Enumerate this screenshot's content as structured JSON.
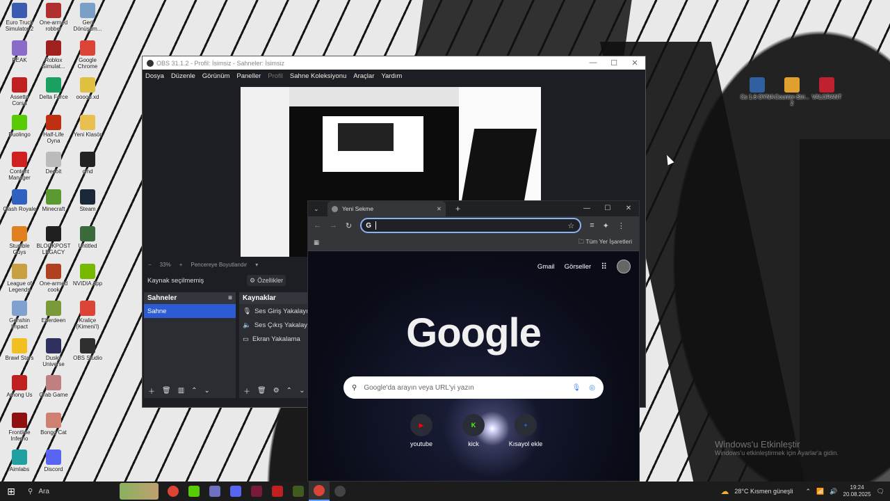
{
  "desktop": {
    "icons_left": [
      {
        "label": "Euro Truck Simulator 2",
        "color": "#3a5bb0"
      },
      {
        "label": "One-armed robber",
        "color": "#b03030"
      },
      {
        "label": "Geri Dönüşüm...",
        "color": "#7aa0c8"
      },
      {
        "label": "PEAK",
        "color": "#8a6bc8"
      },
      {
        "label": "Roblox Simulat...",
        "color": "#a02020"
      },
      {
        "label": "Google Chrome",
        "color": "#db4437"
      },
      {
        "label": "Assetto Corsa",
        "color": "#c02020"
      },
      {
        "label": "Delta Force",
        "color": "#1aa060"
      },
      {
        "label": "ooooo.xd",
        "color": "#e0c040"
      },
      {
        "label": "Duolingo",
        "color": "#58cc02"
      },
      {
        "label": "Half-Life Oyna",
        "color": "#c03010"
      },
      {
        "label": "Yeni Klasör",
        "color": "#e8c050"
      },
      {
        "label": "Content Manager",
        "color": "#d02020"
      },
      {
        "label": "Decoit",
        "color": "#bbbbbb"
      },
      {
        "label": "cmd",
        "color": "#222222"
      },
      {
        "label": "Clash Royale",
        "color": "#3060c0"
      },
      {
        "label": "Minecraft",
        "color": "#5a9a30"
      },
      {
        "label": "Steam",
        "color": "#1b2838"
      },
      {
        "label": "Stumble Guys",
        "color": "#e08020"
      },
      {
        "label": "BLOCKPOST LEGACY",
        "color": "#202020"
      },
      {
        "label": "Untitled",
        "color": "#3a6a3a"
      },
      {
        "label": "League of Legends",
        "color": "#c8a040"
      },
      {
        "label": "One-armed cook",
        "color": "#b04020"
      },
      {
        "label": "NVIDIA App",
        "color": "#76b900"
      },
      {
        "label": "Genshin Impact",
        "color": "#80a0d0"
      },
      {
        "label": "Eberdeen",
        "color": "#7a9a3a"
      },
      {
        "label": "Kraliçe (Kimeni'l)",
        "color": "#db4437"
      },
      {
        "label": "Brawl Stars",
        "color": "#f0c020"
      },
      {
        "label": "Dusky Universe",
        "color": "#303060"
      },
      {
        "label": "OBS Studio",
        "color": "#302e31"
      },
      {
        "label": "Among Us",
        "color": "#c02020"
      },
      {
        "label": "Crab Game",
        "color": "#c08080"
      },
      {
        "label": "",
        "color": ""
      },
      {
        "label": "Frontline Inferno",
        "color": "#901010"
      },
      {
        "label": "Bongo Cat",
        "color": "#d08070"
      },
      {
        "label": "",
        "color": ""
      },
      {
        "label": "Aimlabs",
        "color": "#20a0a0"
      },
      {
        "label": "Discord",
        "color": "#5865f2"
      },
      {
        "label": "",
        "color": ""
      }
    ],
    "icons_right": [
      {
        "label": "Cs 1.6 OYNA",
        "color": "#3060a0"
      },
      {
        "label": "Counter-Stri... 2",
        "color": "#e0a030"
      },
      {
        "label": "VALORANT",
        "color": "#c02030"
      }
    ],
    "activation": {
      "line1": "Windows'u Etkinleştir",
      "line2": "Windows'u etkinleştirmek için Ayarlar'a gidin."
    }
  },
  "obs": {
    "title": "OBS 31.1.2 - Profil: İsimsiz - Sahneler: İsimsiz",
    "window_controls": [
      "—",
      "☐",
      "✕"
    ],
    "menu": [
      {
        "label": "Dosya",
        "dim": false
      },
      {
        "label": "Düzenle",
        "dim": false
      },
      {
        "label": "Görünüm",
        "dim": false
      },
      {
        "label": "Paneller",
        "dim": false
      },
      {
        "label": "Profil",
        "dim": true
      },
      {
        "label": "Sahne Koleksiyonu",
        "dim": false
      },
      {
        "label": "Araçlar",
        "dim": false
      },
      {
        "label": "Yardım",
        "dim": false
      }
    ],
    "zoom": {
      "minus": "−",
      "value": "33%",
      "plus": "+",
      "fit": "Pencereye Boyutlandır",
      "dropdown": "▾"
    },
    "source_status": "Kaynak seçilmemiş",
    "properties_label": "Özellikler",
    "scenes": {
      "header": "Sahneler",
      "items": [
        "Sahne"
      ]
    },
    "sources": {
      "header": "Kaynaklar",
      "items": [
        {
          "label": "Ses Giriş Yakalayıcı",
          "icon": "microphone-icon"
        },
        {
          "label": "Ses Çıkış Yakalayıcı",
          "icon": "speaker-icon"
        },
        {
          "label": "Ekran Yakalama",
          "icon": "monitor-icon"
        }
      ]
    }
  },
  "chrome": {
    "tab_title": "Yeni Sekme",
    "bookmarks_label": "Tüm Yer İşaretleri",
    "top_links": [
      "Gmail",
      "Görseller"
    ],
    "logo": "Google",
    "search_placeholder": "Google'da arayın veya URL'yi yazın",
    "shortcuts": [
      {
        "label": "youtube",
        "glyph": "▶",
        "color": "#ff0000"
      },
      {
        "label": "kick",
        "glyph": "K",
        "color": "#53fc18"
      },
      {
        "label": "Kısayol ekle",
        "glyph": "+",
        "color": "#1a73e8"
      }
    ]
  },
  "taskbar": {
    "search_label": "Ara",
    "weather": "28°C  Kısmen güneşli",
    "time": "19:24",
    "date": "20.08.2025",
    "apps": [
      {
        "name": "chrome",
        "color": "#db4437"
      },
      {
        "name": "duolingo",
        "color": "#58cc02"
      },
      {
        "name": "app",
        "color": "#7070c0"
      },
      {
        "name": "discord",
        "color": "#5865f2"
      },
      {
        "name": "app2",
        "color": "#7a1a3a"
      },
      {
        "name": "assetto",
        "color": "#c02020"
      },
      {
        "name": "app3",
        "color": "#405a20"
      },
      {
        "name": "chrome-active",
        "color": "#db4437"
      },
      {
        "name": "obs",
        "color": "#444444"
      }
    ]
  }
}
